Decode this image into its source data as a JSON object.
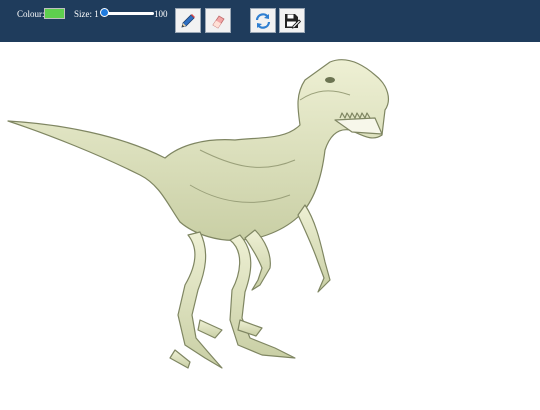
{
  "toolbar": {
    "colour_label": "Colour:",
    "colour_value": "#5ecf4e",
    "size_label": "Size: 1",
    "size_max": "100",
    "size_fraction": 0.05
  },
  "tools": [
    {
      "name": "pencil-button",
      "icon": "pencil-icon"
    },
    {
      "name": "eraser-button",
      "icon": "eraser-icon"
    },
    {
      "name": "refresh-button",
      "icon": "refresh-icon"
    },
    {
      "name": "save-button",
      "icon": "save-icon"
    }
  ],
  "colors": {
    "toolbar_bg": "#1f3c5c",
    "accent": "#1e7be0",
    "dino_body": "#dfe3c2",
    "dino_shade": "#9aa07a"
  }
}
